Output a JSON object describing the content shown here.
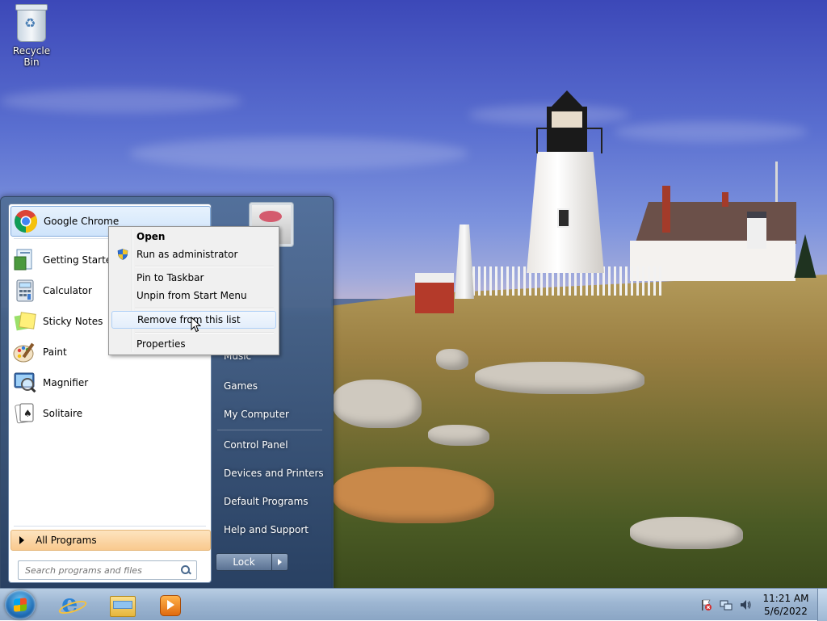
{
  "desktop": {
    "icons": [
      {
        "label": "Recycle Bin",
        "icon": "recycle-bin-icon"
      }
    ]
  },
  "start_menu": {
    "programs": [
      {
        "label": "Google Chrome",
        "icon": "chrome-icon",
        "highlighted": true
      },
      {
        "label": "Getting Started",
        "icon": "getting-started-icon"
      },
      {
        "label": "Calculator",
        "icon": "calculator-icon"
      },
      {
        "label": "Sticky Notes",
        "icon": "sticky-notes-icon"
      },
      {
        "label": "Paint",
        "icon": "paint-icon"
      },
      {
        "label": "Magnifier",
        "icon": "magnifier-icon"
      },
      {
        "label": "Solitaire",
        "icon": "solitaire-icon"
      }
    ],
    "all_programs": "All Programs",
    "search_placeholder": "Search programs and files",
    "right_items": [
      {
        "label": "Music"
      },
      {
        "label": "Games"
      },
      {
        "label": "My Computer"
      },
      {
        "label": "Control Panel"
      },
      {
        "label": "Devices and Printers"
      },
      {
        "label": "Default Programs"
      },
      {
        "label": "Help and Support"
      }
    ],
    "lock_label": "Lock"
  },
  "context_menu": {
    "items": [
      {
        "label": "Open",
        "bold": true
      },
      {
        "label": "Run as administrator",
        "icon": "uac-shield-icon"
      },
      {
        "label": "Pin to Taskbar"
      },
      {
        "label": "Unpin from Start Menu"
      },
      {
        "label": "Remove from this list",
        "highlighted": true
      },
      {
        "label": "Properties"
      }
    ]
  },
  "taskbar": {
    "apps": [
      {
        "icon": "internet-explorer-icon"
      },
      {
        "icon": "file-explorer-icon"
      },
      {
        "icon": "media-player-icon"
      }
    ],
    "tray_icons": [
      "action-center-flag-icon",
      "network-icon",
      "volume-icon"
    ],
    "time": "11:21 AM",
    "date": "5/6/2022"
  },
  "colors": {
    "accent_highlight": "#cfe4fb",
    "all_programs_bg": "#f9c98e",
    "taskbar": "#9db6d2"
  }
}
